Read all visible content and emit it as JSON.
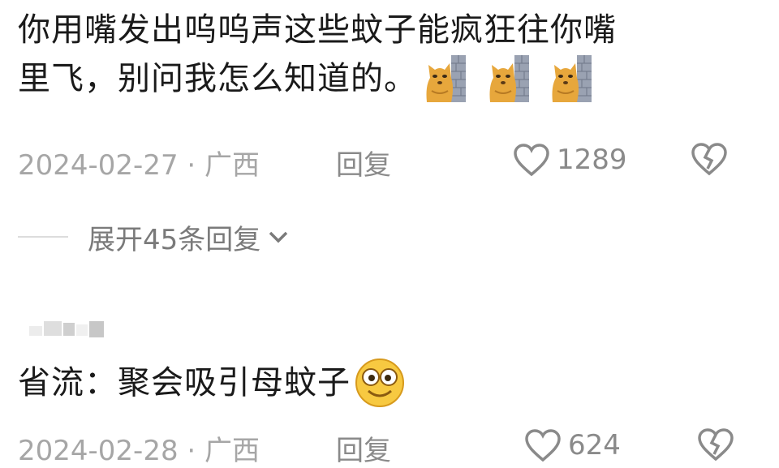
{
  "comment1": {
    "line1": "你用嘴发出呜呜声这些蚊子能疯狂往你嘴",
    "line2": "里飞，别问我怎么知道的。",
    "emoji": "cat-behind-wall-emoji",
    "date": "2024-02-27 · 广西",
    "reply": "回复",
    "likes": "1289"
  },
  "expand": {
    "label": "展开45条回复"
  },
  "comment2": {
    "text": "省流：聚会吸引母蚊子",
    "emoji": "smiley-emoji",
    "date": "2024-02-28 · 广西",
    "reply": "回复",
    "likes": "624"
  },
  "colors": {
    "text": "#1a1a1a",
    "meta": "#a6a6a6",
    "heart": "#8a8a8a",
    "bear": "#e7a73c",
    "wall": "#8d96a8"
  }
}
